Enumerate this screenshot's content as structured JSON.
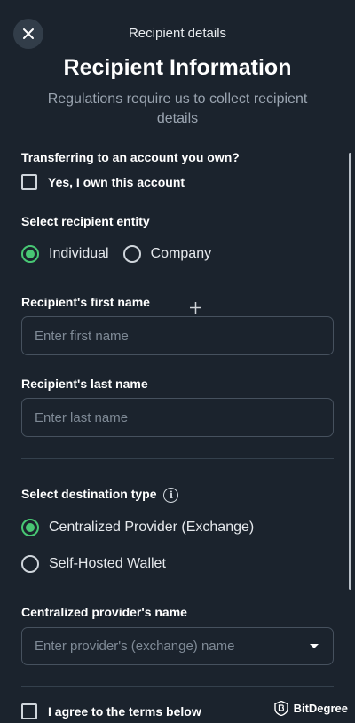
{
  "header": {
    "title": "Recipient details"
  },
  "main": {
    "title": "Recipient Information",
    "subtitle": "Regulations require us to collect recipient details"
  },
  "own_account": {
    "question": "Transferring to an account you own?",
    "checkbox_label": "Yes, I own this account",
    "checked": false
  },
  "entity": {
    "label": "Select recipient entity",
    "options": [
      "Individual",
      "Company"
    ],
    "selected": "Individual"
  },
  "first_name": {
    "label": "Recipient's first name",
    "placeholder": "Enter first name",
    "value": ""
  },
  "last_name": {
    "label": "Recipient's last name",
    "placeholder": "Enter last name",
    "value": ""
  },
  "destination": {
    "label": "Select destination type",
    "options": [
      "Centralized Provider (Exchange)",
      "Self-Hosted Wallet"
    ],
    "selected": "Centralized Provider (Exchange)"
  },
  "provider": {
    "label": "Centralized provider's name",
    "placeholder": "Enter provider's (exchange) name"
  },
  "terms": {
    "checkbox_label": "I agree to the terms below",
    "checked": false
  },
  "watermark": {
    "text": "BitDegree"
  },
  "colors": {
    "background": "#1b232d",
    "accent_green": "#48c774",
    "input_border": "#46515e"
  },
  "icons": {
    "close": "close-icon",
    "info": "info-icon",
    "dropdown": "chevron-down-icon",
    "cursor": "crosshair-cursor-icon"
  }
}
